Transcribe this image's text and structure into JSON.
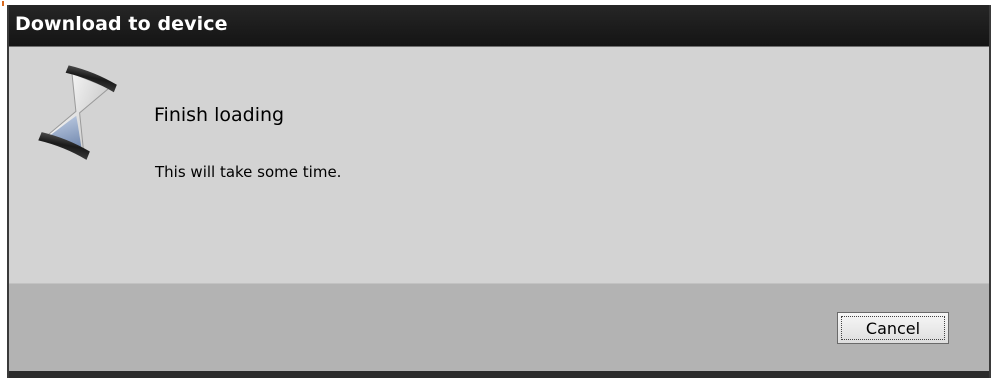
{
  "dialog": {
    "title": "Download to device",
    "heading": "Finish loading",
    "message": "This will take some time.",
    "status_icon": "hourglass-icon",
    "cancel_label": "Cancel"
  },
  "colors": {
    "titlebar": "#1e1e1e",
    "title_text": "#ffffff",
    "content_background": "#d3d3d3",
    "footer_background": "#b3b3b3",
    "hourglass_sand": "#8fa3c4"
  }
}
